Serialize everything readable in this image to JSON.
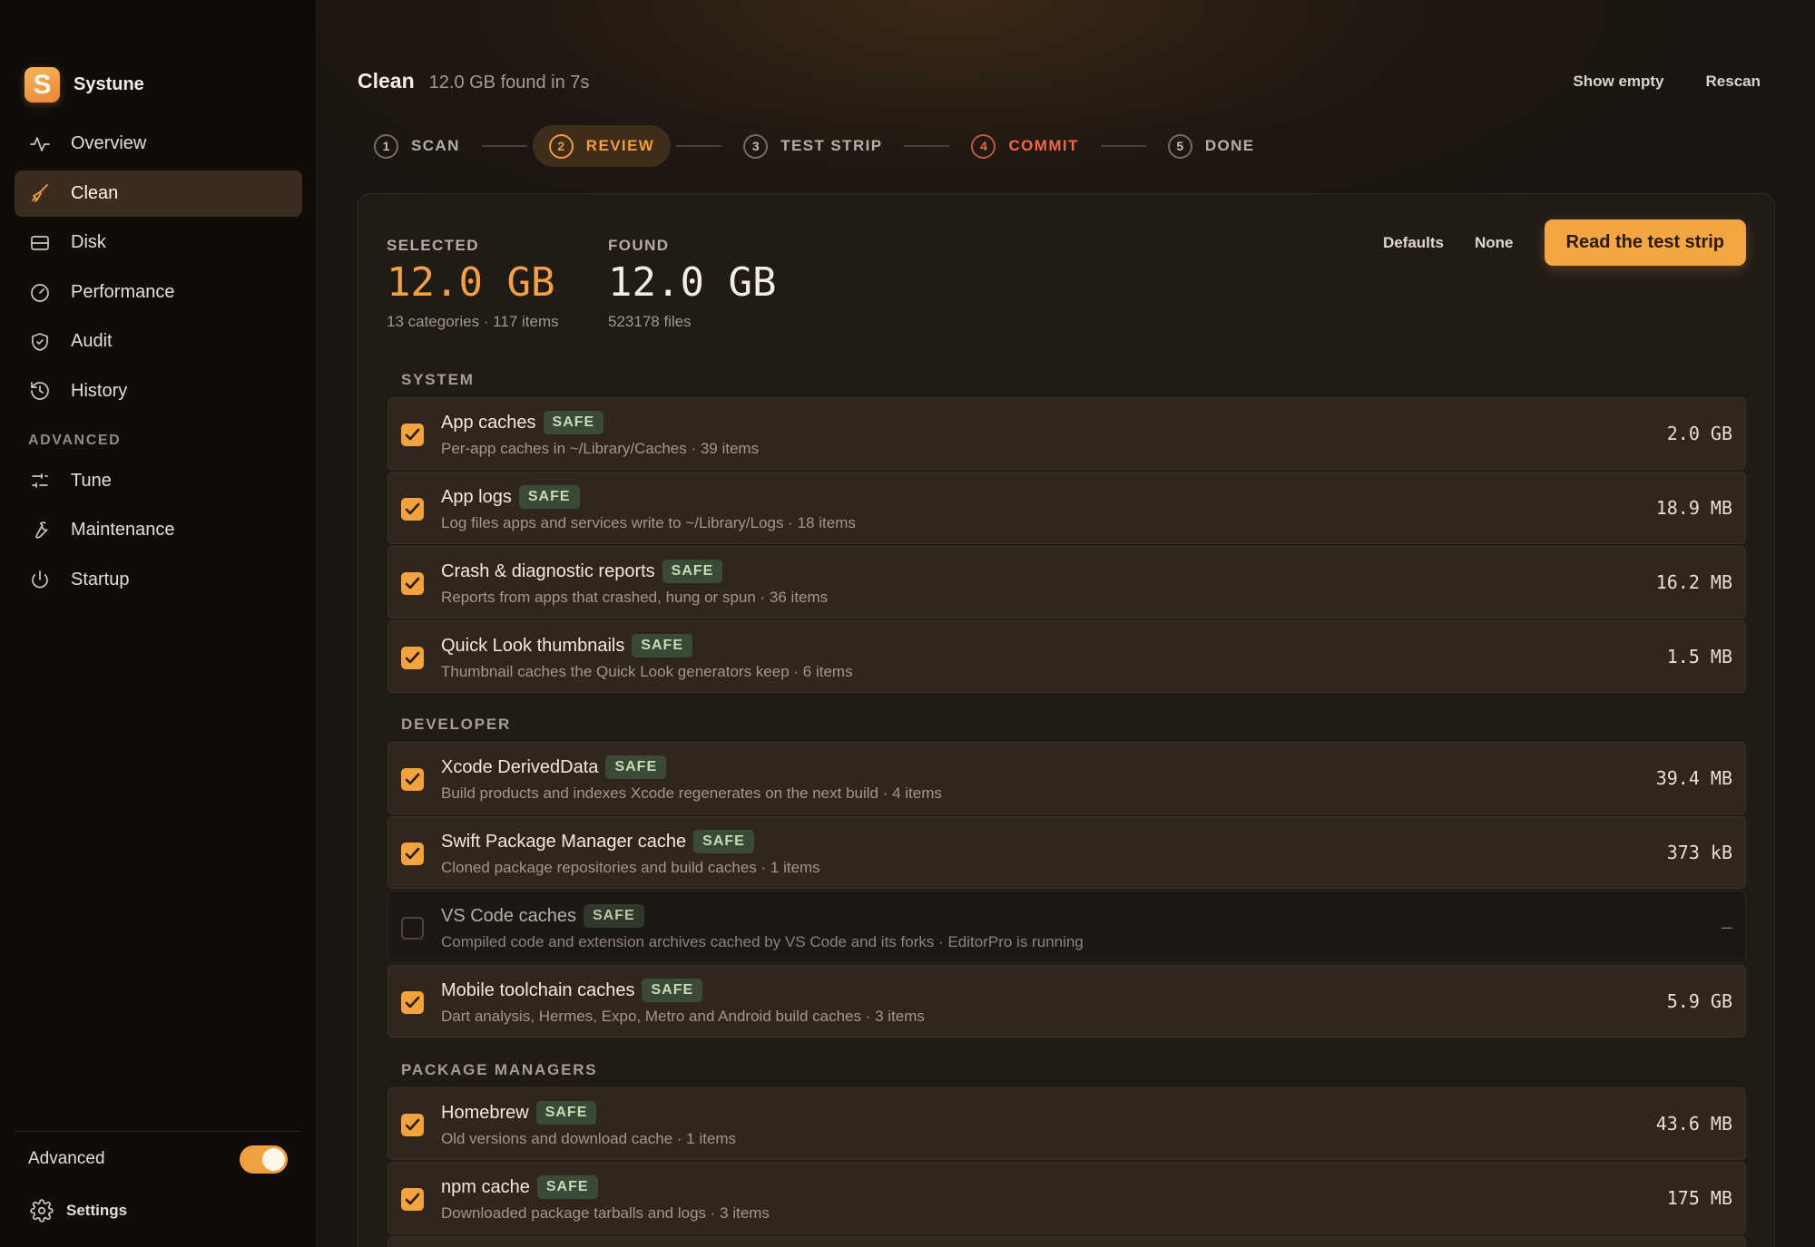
{
  "app": {
    "name": "Systune",
    "logo_letter": "S"
  },
  "sidebar": {
    "items": [
      {
        "label": "Overview",
        "icon": "activity-icon"
      },
      {
        "label": "Clean",
        "icon": "broom-icon"
      },
      {
        "label": "Disk",
        "icon": "disk-icon"
      },
      {
        "label": "Performance",
        "icon": "gauge-icon"
      },
      {
        "label": "Audit",
        "icon": "shield-icon"
      },
      {
        "label": "History",
        "icon": "history-icon"
      }
    ],
    "advanced_section": "ADVANCED",
    "advanced_items": [
      {
        "label": "Tune",
        "icon": "sliders-icon"
      },
      {
        "label": "Maintenance",
        "icon": "wrench-icon"
      },
      {
        "label": "Startup",
        "icon": "power-icon"
      }
    ],
    "advanced_toggle_label": "Advanced",
    "advanced_toggle_on": true,
    "settings_label": "Settings"
  },
  "header": {
    "title": "Clean",
    "subtitle": "12.0 GB found in 7s",
    "show_empty": "Show empty",
    "rescan": "Rescan"
  },
  "steps": [
    {
      "num": "1",
      "label": "SCAN",
      "state": "done"
    },
    {
      "num": "2",
      "label": "REVIEW",
      "state": "active"
    },
    {
      "num": "3",
      "label": "TEST STRIP",
      "state": "pending"
    },
    {
      "num": "4",
      "label": "COMMIT",
      "state": "warn"
    },
    {
      "num": "5",
      "label": "DONE",
      "state": "pending"
    }
  ],
  "summary": {
    "selected_label": "SELECTED",
    "selected_value": "12.0 GB",
    "selected_sub": "13 categories · 117 items",
    "found_label": "FOUND",
    "found_value": "12.0 GB",
    "found_sub": "523178 files",
    "defaults": "Defaults",
    "none": "None",
    "primary": "Read the test strip"
  },
  "sections": [
    {
      "title": "SYSTEM",
      "rows": [
        {
          "name": "App caches",
          "badge": "SAFE",
          "desc": "Per-app caches in ~/Library/Caches · 39 items",
          "size": "2.0 GB",
          "checked": true
        },
        {
          "name": "App logs",
          "badge": "SAFE",
          "desc": "Log files apps and services write to ~/Library/Logs · 18 items",
          "size": "18.9 MB",
          "checked": true
        },
        {
          "name": "Crash & diagnostic reports",
          "badge": "SAFE",
          "desc": "Reports from apps that crashed, hung or spun · 36 items",
          "size": "16.2 MB",
          "checked": true
        },
        {
          "name": "Quick Look thumbnails",
          "badge": "SAFE",
          "desc": "Thumbnail caches the Quick Look generators keep · 6 items",
          "size": "1.5 MB",
          "checked": true
        }
      ]
    },
    {
      "title": "DEVELOPER",
      "rows": [
        {
          "name": "Xcode DerivedData",
          "badge": "SAFE",
          "desc": "Build products and indexes Xcode regenerates on the next build · 4 items",
          "size": "39.4 MB",
          "checked": true
        },
        {
          "name": "Swift Package Manager cache",
          "badge": "SAFE",
          "desc": "Cloned package repositories and build caches · 1 items",
          "size": "373 kB",
          "checked": true
        },
        {
          "name": "VS Code caches",
          "badge": "SAFE",
          "desc": "Compiled code and extension archives cached by VS Code and its forks · EditorPro is running",
          "size": "—",
          "checked": false
        },
        {
          "name": "Mobile toolchain caches",
          "badge": "SAFE",
          "desc": "Dart analysis, Hermes, Expo, Metro and Android build caches · 3 items",
          "size": "5.9 GB",
          "checked": true
        }
      ]
    },
    {
      "title": "PACKAGE MANAGERS",
      "rows": [
        {
          "name": "Homebrew",
          "badge": "SAFE",
          "desc": "Old versions and download cache · 1 items",
          "size": "43.6 MB",
          "checked": true
        },
        {
          "name": "npm cache",
          "badge": "SAFE",
          "desc": "Downloaded package tarballs and logs · 3 items",
          "size": "175 MB",
          "checked": true
        }
      ]
    }
  ],
  "colors": {
    "accent": "#f3a641",
    "warn": "#f0684a",
    "safe_badge": "#3b4a36"
  }
}
